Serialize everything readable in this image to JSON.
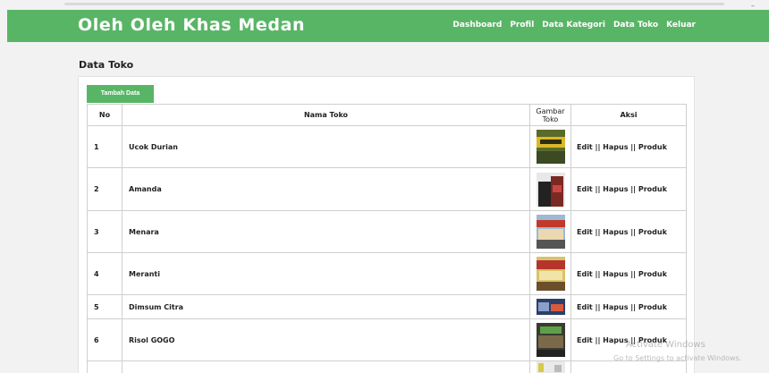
{
  "header": {
    "brand": "Oleh Oleh Khas Medan",
    "nav": [
      "Dashboard",
      "Profil",
      "Data Kategori",
      "Data Toko",
      "Keluar"
    ]
  },
  "page": {
    "heading": "Data Toko",
    "add_button": "Tambah Data"
  },
  "table": {
    "columns": [
      "No",
      "Nama Toko",
      "Gambar Toko",
      "Aksi"
    ],
    "rows": [
      {
        "no": "1",
        "nama": "Ucok Durian",
        "aksi": "Edit || Hapus || Produk"
      },
      {
        "no": "2",
        "nama": "Amanda",
        "aksi": "Edit || Hapus || Produk"
      },
      {
        "no": "3",
        "nama": "Menara",
        "aksi": "Edit || Hapus || Produk"
      },
      {
        "no": "4",
        "nama": "Meranti",
        "aksi": "Edit || Hapus || Produk"
      },
      {
        "no": "5",
        "nama": "Dimsum Citra",
        "aksi": "Edit || Hapus || Produk"
      },
      {
        "no": "6",
        "nama": "Risol GOGO",
        "aksi": "Edit || Hapus || Produk"
      },
      {
        "no": "",
        "nama": "",
        "aksi": ""
      }
    ]
  },
  "watermark": {
    "title": "Activate Windows",
    "subtitle": "Go to Settings to activate Windows."
  },
  "colors": {
    "accent": "#59b566",
    "background": "#f2f2f2"
  }
}
